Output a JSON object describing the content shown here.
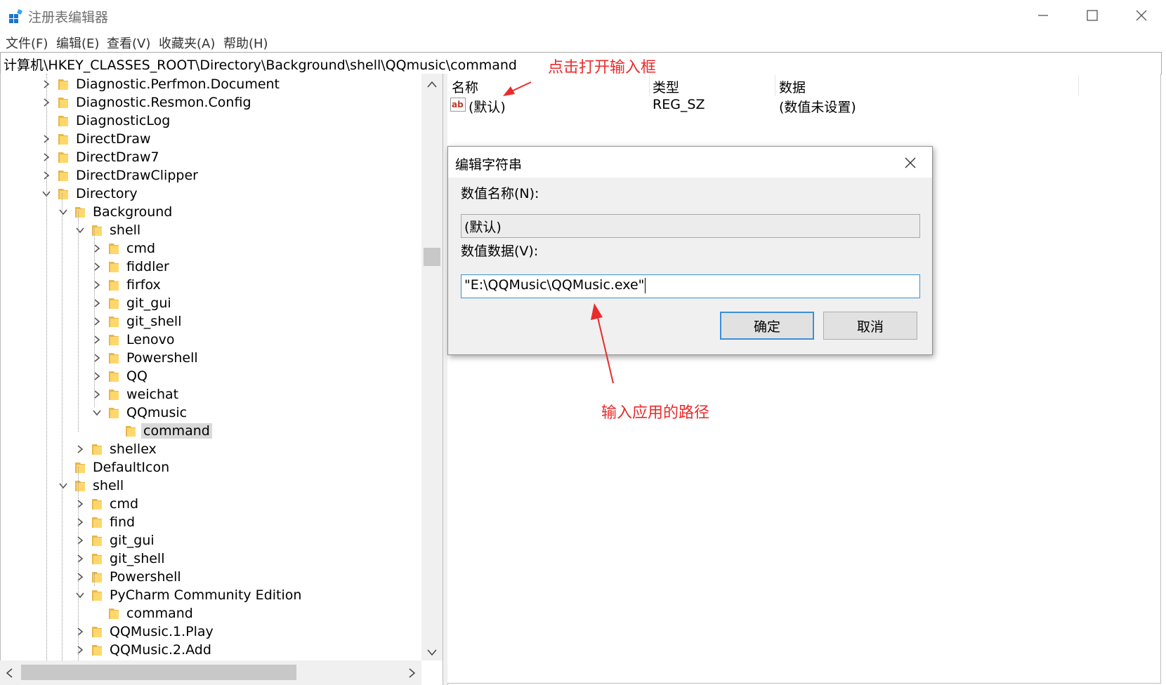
{
  "window": {
    "title": "注册表编辑器",
    "icon": "registry-editor-icon"
  },
  "menu": [
    "文件(F)",
    "编辑(E)",
    "查看(V)",
    "收藏夹(A)",
    "帮助(H)"
  ],
  "address": "计算机\\HKEY_CLASSES_ROOT\\Directory\\Background\\shell\\QQmusic\\command",
  "tree": [
    {
      "label": "Diagnostic.Perfmon.Document",
      "depth": 0,
      "state": "collapsed"
    },
    {
      "label": "Diagnostic.Resmon.Config",
      "depth": 0,
      "state": "collapsed"
    },
    {
      "label": "DiagnosticLog",
      "depth": 0,
      "state": "none"
    },
    {
      "label": "DirectDraw",
      "depth": 0,
      "state": "collapsed"
    },
    {
      "label": "DirectDraw7",
      "depth": 0,
      "state": "collapsed"
    },
    {
      "label": "DirectDrawClipper",
      "depth": 0,
      "state": "collapsed"
    },
    {
      "label": "Directory",
      "depth": 0,
      "state": "expanded"
    },
    {
      "label": "Background",
      "depth": 1,
      "state": "expanded"
    },
    {
      "label": "shell",
      "depth": 2,
      "state": "expanded"
    },
    {
      "label": "cmd",
      "depth": 3,
      "state": "collapsed"
    },
    {
      "label": "fiddler",
      "depth": 3,
      "state": "collapsed"
    },
    {
      "label": "firfox",
      "depth": 3,
      "state": "collapsed"
    },
    {
      "label": "git_gui",
      "depth": 3,
      "state": "collapsed"
    },
    {
      "label": "git_shell",
      "depth": 3,
      "state": "collapsed"
    },
    {
      "label": "Lenovo",
      "depth": 3,
      "state": "collapsed"
    },
    {
      "label": "Powershell",
      "depth": 3,
      "state": "collapsed"
    },
    {
      "label": "QQ",
      "depth": 3,
      "state": "collapsed"
    },
    {
      "label": "weichat",
      "depth": 3,
      "state": "collapsed"
    },
    {
      "label": "QQmusic",
      "depth": 3,
      "state": "expanded"
    },
    {
      "label": "command",
      "depth": 4,
      "state": "none",
      "selected": true
    },
    {
      "label": "shellex",
      "depth": 2,
      "state": "collapsed"
    },
    {
      "label": "DefaultIcon",
      "depth": 1,
      "state": "none"
    },
    {
      "label": "shell",
      "depth": 1,
      "state": "expanded"
    },
    {
      "label": "cmd",
      "depth": 2,
      "state": "collapsed"
    },
    {
      "label": "find",
      "depth": 2,
      "state": "collapsed"
    },
    {
      "label": "git_gui",
      "depth": 2,
      "state": "collapsed"
    },
    {
      "label": "git_shell",
      "depth": 2,
      "state": "collapsed"
    },
    {
      "label": "Powershell",
      "depth": 2,
      "state": "collapsed"
    },
    {
      "label": "PyCharm Community Edition",
      "depth": 2,
      "state": "expanded"
    },
    {
      "label": "command",
      "depth": 3,
      "state": "none"
    },
    {
      "label": "QQMusic.1.Play",
      "depth": 2,
      "state": "collapsed"
    },
    {
      "label": "QQMusic.2.Add",
      "depth": 2,
      "state": "collapsed"
    }
  ],
  "list": {
    "columns": [
      "名称",
      "类型",
      "数据"
    ],
    "rows": [
      {
        "name": "(默认)",
        "type": "REG_SZ",
        "data": "(数值未设置)",
        "icon": "string-value-icon"
      }
    ]
  },
  "dialog": {
    "title": "编辑字符串",
    "name_label": "数值名称(N):",
    "name_value": "(默认)",
    "data_label": "数值数据(V):",
    "data_value": "\"E:\\QQMusic\\QQMusic.exe\"",
    "ok": "确定",
    "cancel": "取消"
  },
  "annotations": {
    "top": "点击打开输入框",
    "bottom": "输入应用的路径",
    "color": "#ea2b2b"
  }
}
